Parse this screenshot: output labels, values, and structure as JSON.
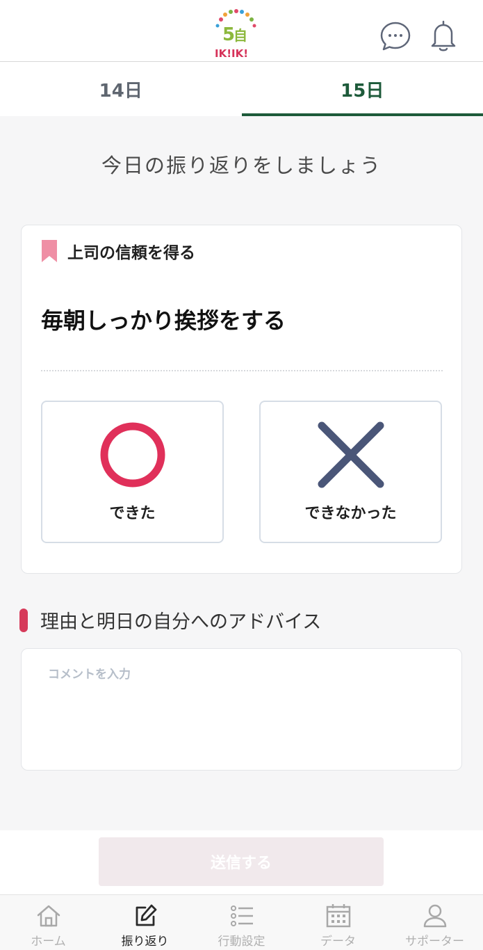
{
  "header": {
    "logo_text": "IK!IK!",
    "logo_number": "5自"
  },
  "tabs": [
    {
      "label": "14日",
      "active": false
    },
    {
      "label": "15日",
      "active": true
    }
  ],
  "prompt": "今日の振り返りをしましょう",
  "card": {
    "goal": "上司の信頼を得る",
    "action": "毎朝しっかり挨拶をする",
    "choices": {
      "done": "できた",
      "not_done": "できなかった"
    }
  },
  "advice": {
    "title": "理由と明日の自分へのアドバイス",
    "placeholder": "コメントを入力"
  },
  "submit_label": "送信する",
  "nav": [
    {
      "label": "ホーム",
      "icon": "home-icon"
    },
    {
      "label": "振り返り",
      "icon": "edit-icon",
      "active": true
    },
    {
      "label": "行動設定",
      "icon": "list-icon"
    },
    {
      "label": "データ",
      "icon": "calendar-icon"
    },
    {
      "label": "サポーター",
      "icon": "user-icon"
    }
  ],
  "colors": {
    "accent_green": "#1d5a3a",
    "done_red": "#e0305a",
    "not_done_navy": "#4a5678",
    "section_bar": "#d63a5a"
  }
}
